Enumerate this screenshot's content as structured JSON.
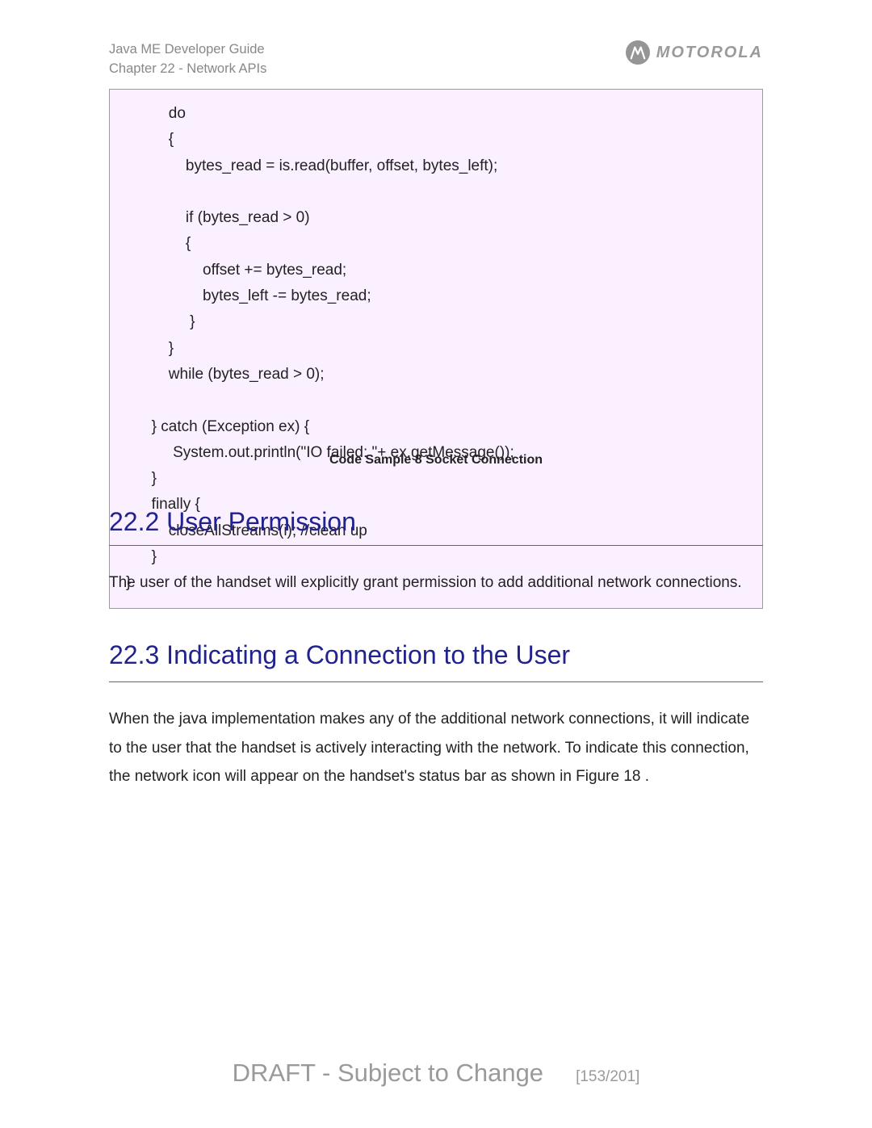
{
  "header": {
    "line1": "Java ME Developer Guide",
    "line2": "Chapter 22 - Network APIs",
    "brand": "MOTOROLA"
  },
  "code": {
    "content": "          do\n          {\n              bytes_read = is.read(buffer, offset, bytes_left);\n\n              if (bytes_read > 0)\n              {\n                  offset += bytes_read;\n                  bytes_left -= bytes_read;\n               }\n          }\n          while (bytes_read > 0);\n\n      } catch (Exception ex) {\n           System.out.println(\"IO failed: \"+ ex.getMessage());\n      }\n      finally {\n          closeAllStreams(i); //clean up\n      }\n}",
    "caption": "Code Sample 8 Socket Connection"
  },
  "section222": {
    "heading": "22.2 User Permission",
    "body": "The user of the handset will explicitly grant permission to add additional network connections."
  },
  "section223": {
    "heading": "22.3 Indicating a Connection to the User",
    "body": "When the java implementation makes any of the additional network connections, it will indicate to the user that the handset is actively interacting with the network. To indicate this connection, the network icon will appear on the handset's status bar as shown in Figure 18 ."
  },
  "footer": {
    "draft": "DRAFT - Subject to Change",
    "page": "[153/201]"
  }
}
